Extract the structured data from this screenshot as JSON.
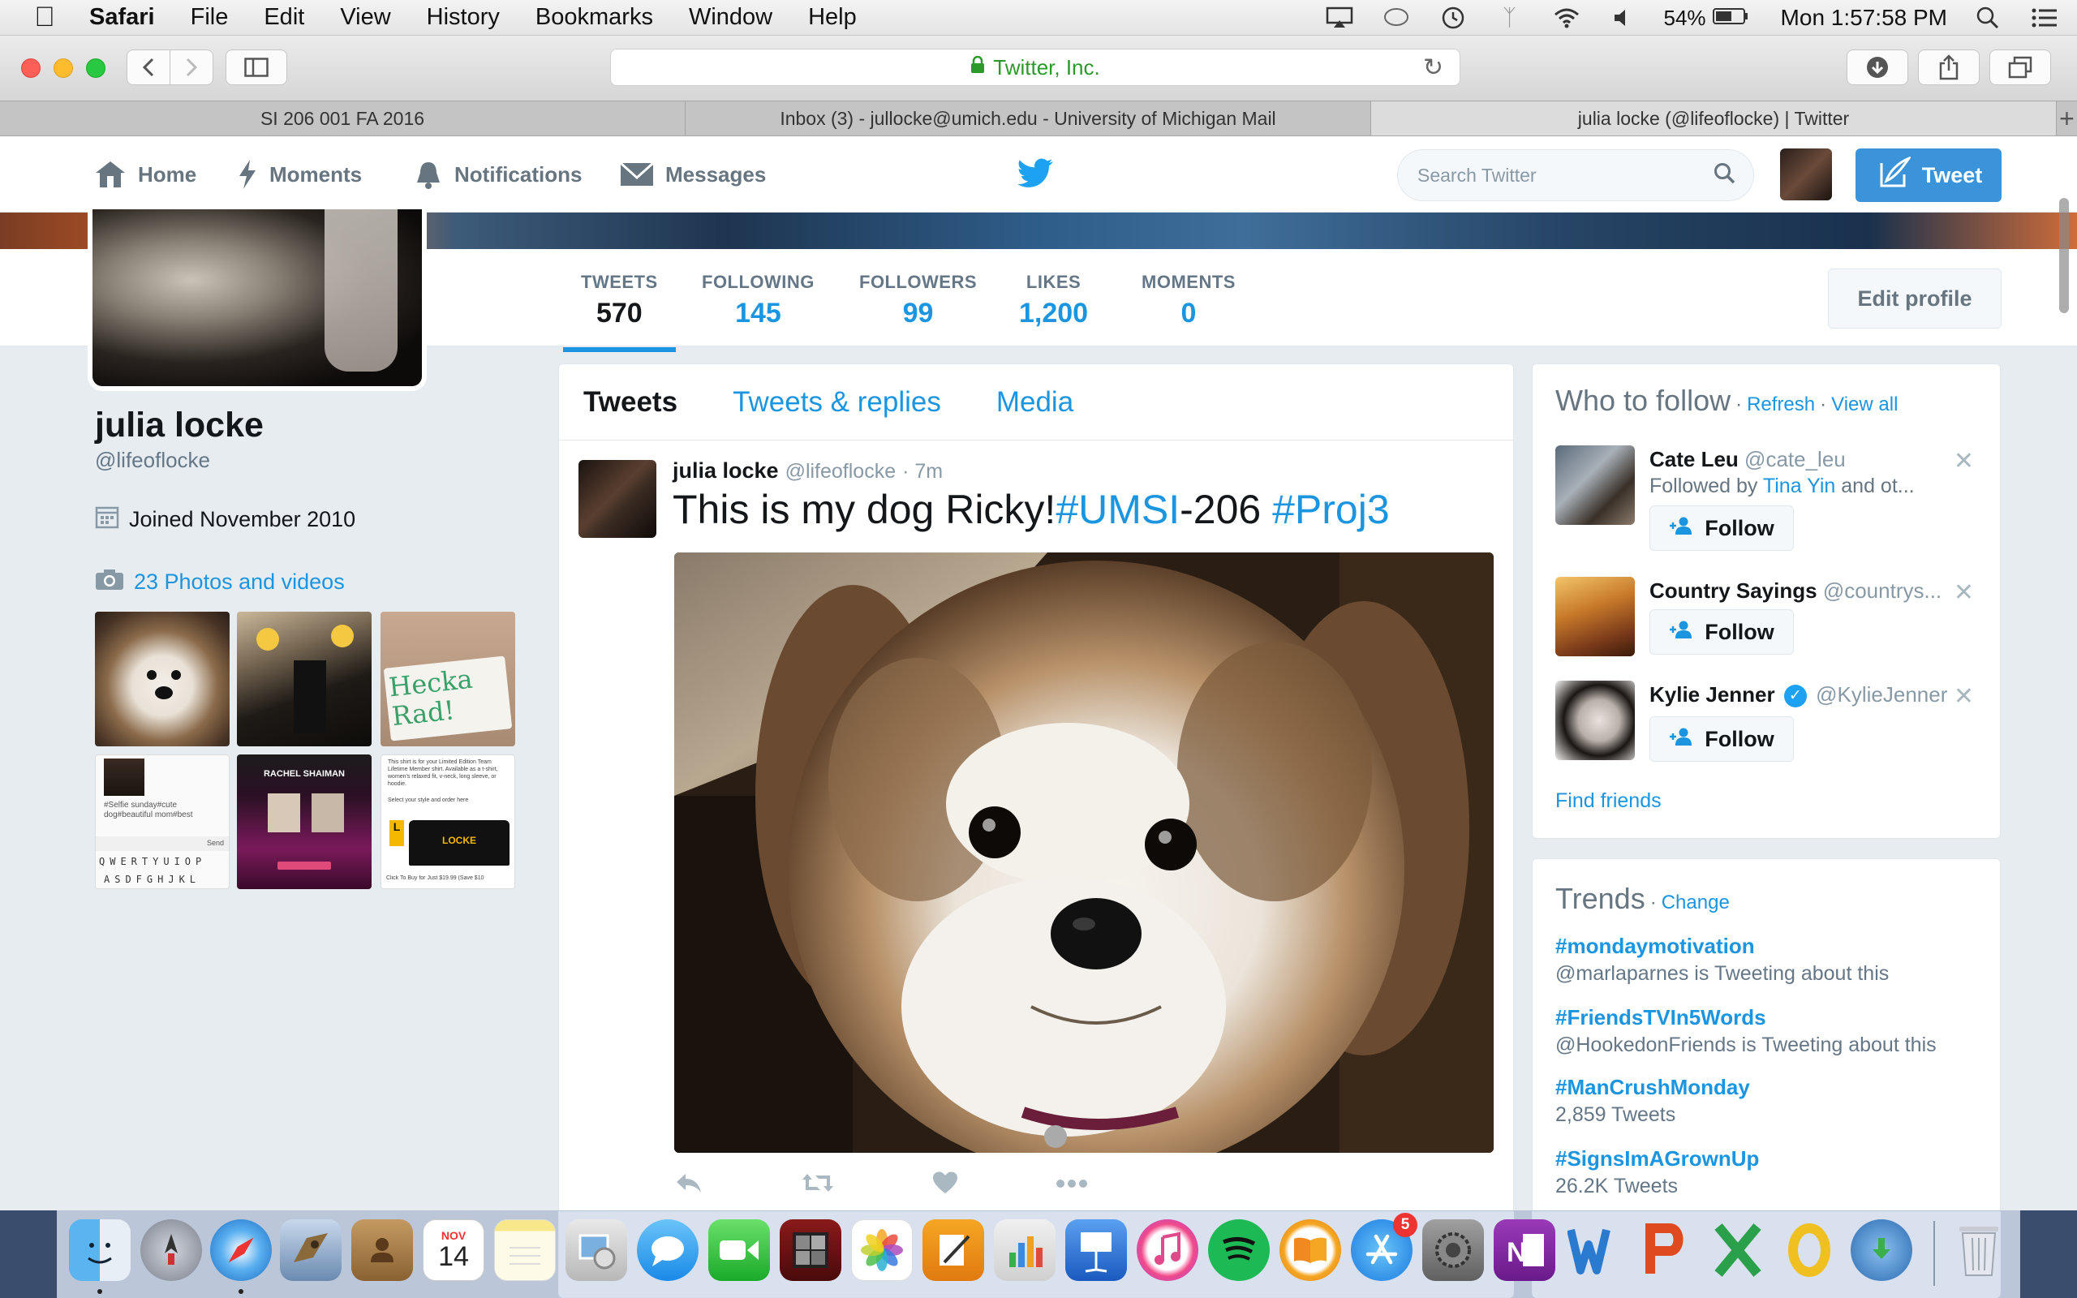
{
  "menubar": {
    "app": "Safari",
    "items": [
      "File",
      "Edit",
      "View",
      "History",
      "Bookmarks",
      "Window",
      "Help"
    ],
    "battery": "54%",
    "clock": "Mon 1:57:58 PM",
    "icons": [
      "airplay-icon",
      "message-icon",
      "time-machine-icon",
      "bluetooth-icon",
      "wifi-icon",
      "volume-icon",
      "battery-icon",
      "spotlight-icon",
      "notification-center-icon"
    ]
  },
  "safari": {
    "url_label": "Twitter, Inc.",
    "tabs": [
      {
        "label": "SI 206 001 FA 2016",
        "active": false
      },
      {
        "label": "Inbox (3) - jullocke@umich.edu - University of Michigan Mail",
        "active": false
      },
      {
        "label": "julia locke (@lifeoflocke) | Twitter",
        "active": true
      }
    ],
    "new_tab": "+"
  },
  "twnav": {
    "home": "Home",
    "moments": "Moments",
    "notifications": "Notifications",
    "messages": "Messages",
    "search_placeholder": "Search Twitter",
    "tweet_button": "Tweet"
  },
  "profile": {
    "name": "julia locke",
    "handle": "@lifeoflocke",
    "joined": "Joined November 2010",
    "photos_link": "23 Photos and videos",
    "edit_profile": "Edit profile",
    "stats": [
      {
        "label": "TWEETS",
        "value": "570",
        "active": true
      },
      {
        "label": "FOLLOWING",
        "value": "145",
        "active": false
      },
      {
        "label": "FOLLOWERS",
        "value": "99",
        "active": false
      },
      {
        "label": "LIKES",
        "value": "1,200",
        "active": false
      },
      {
        "label": "MOMENTS",
        "value": "0",
        "active": false
      }
    ],
    "thumb3_text": "Hecka Rad!",
    "thumb4_caption": "#Selfie sunday#cute dog#beautiful mom#best",
    "thumb4_keys": [
      "QWERTYUIOP",
      "ASDFGHJKL"
    ],
    "thumb4_send": "Send",
    "thumb5_title": "RACHEL SHAIMAN",
    "thumb6_word": "LOCKE",
    "thumb6_text": "This shirt is for your Limited Edition Team Lifetime Member shirt. Available as a t-shirt, women's relaxed fit, v-neck, long sleeve, or hoodie.",
    "thumb6_select": "Select your style and order here",
    "thumb6_price": "Click To Buy for Just $19.99 (Save $10"
  },
  "timeline": {
    "tabs": [
      {
        "label": "Tweets",
        "active": true
      },
      {
        "label": "Tweets & replies",
        "active": false
      },
      {
        "label": "Media",
        "active": false
      }
    ],
    "tweet": {
      "author_name": "julia locke",
      "author_handle": "@lifeoflocke",
      "time": "· 7m",
      "text_plain": "This is my dog Ricky!",
      "hashtag1": "#UMSI",
      "text_mid": "-206 ",
      "hashtag2": "#Proj3"
    }
  },
  "who_to_follow": {
    "title": "Who to follow",
    "sep": "·",
    "refresh": "Refresh",
    "view_all": "View all",
    "follow_label": "Follow",
    "find_friends": "Find friends",
    "suggestions": [
      {
        "name": "Cate Leu",
        "handle": "@cate_leu",
        "sub_prefix": "Followed by ",
        "sub_link": "Tina Yin",
        "sub_suffix": " and ot..."
      },
      {
        "name": "Country Sayings",
        "handle": "@countrys..."
      },
      {
        "name": "Kylie Jenner",
        "handle": "@KylieJenner",
        "verified": true
      }
    ]
  },
  "trends": {
    "title": "Trends",
    "sep": "·",
    "change": "Change",
    "items": [
      {
        "name": "#mondaymotivation",
        "sub": "@marlaparnes is Tweeting about this"
      },
      {
        "name": "#FriendsTVIn5Words",
        "sub": "@HookedonFriends is Tweeting about this"
      },
      {
        "name": "#ManCrushMonday",
        "sub": "2,859 Tweets"
      },
      {
        "name": "#SignsImAGrownUp",
        "sub": "26.2K Tweets"
      }
    ]
  },
  "dock": {
    "calendar_month": "NOV",
    "calendar_day": "14",
    "appstore_badge": "5"
  },
  "colors": {
    "twitter_blue": "#1b95e0",
    "tweet_button": "#3b94d9",
    "bird": "#1da1f2"
  }
}
